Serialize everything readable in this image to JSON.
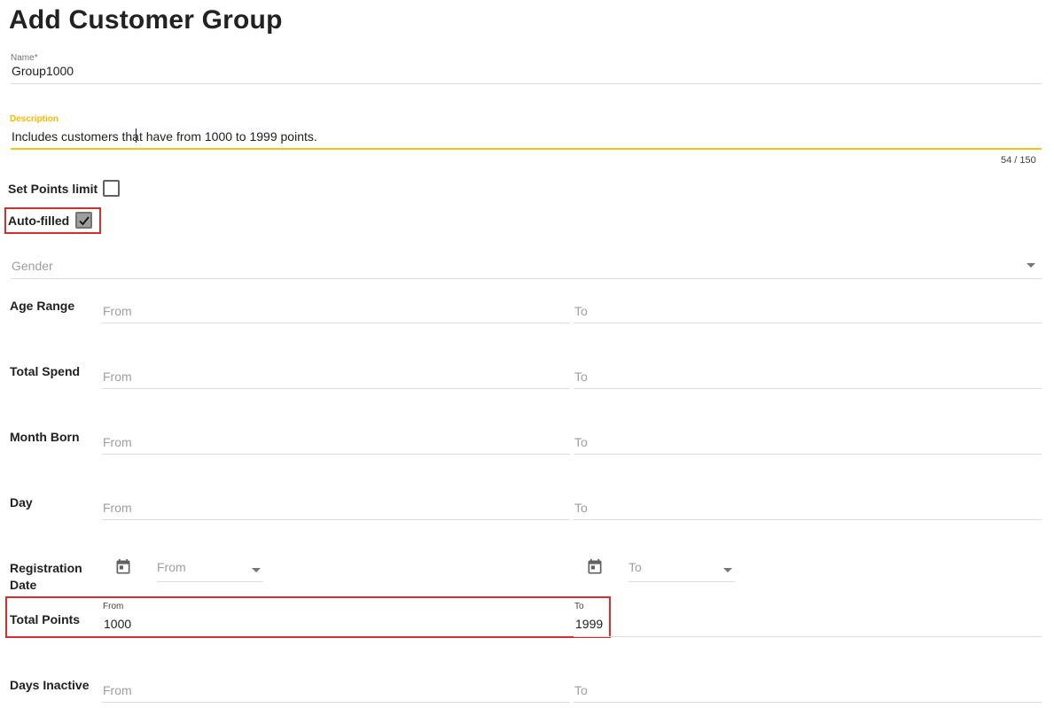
{
  "page": {
    "title": "Add Customer Group"
  },
  "name_field": {
    "label": "Name",
    "required_mark": "*",
    "value": "Group1000"
  },
  "description_field": {
    "label": "Description",
    "value": "Includes customers that have from 1000 to 1999 points.",
    "counter": "54 / 150"
  },
  "set_points_limit": {
    "label": "Set Points limit",
    "checked": false
  },
  "auto_filled": {
    "label": "Auto-filled",
    "checked": true
  },
  "gender": {
    "placeholder": "Gender"
  },
  "rows": {
    "age_range": {
      "label": "Age Range",
      "from": "From",
      "to": "To"
    },
    "total_spend": {
      "label": "Total Spend",
      "from": "From",
      "to": "To"
    },
    "month_born": {
      "label": "Month Born",
      "from": "From",
      "to": "To"
    },
    "day": {
      "label": "Day",
      "from": "From",
      "to": "To"
    },
    "registration_date": {
      "label_line1": "Registration",
      "label_line2": "Date",
      "from": "From",
      "to": "To"
    },
    "total_points": {
      "label": "Total Points",
      "from_label": "From",
      "from_value": "1000",
      "to_label": "To",
      "to_value": "1999"
    },
    "days_inactive": {
      "label": "Days Inactive",
      "from": "From",
      "to": "To"
    }
  },
  "colors": {
    "accent": "#f5c518",
    "highlight": "#d32f2f"
  }
}
